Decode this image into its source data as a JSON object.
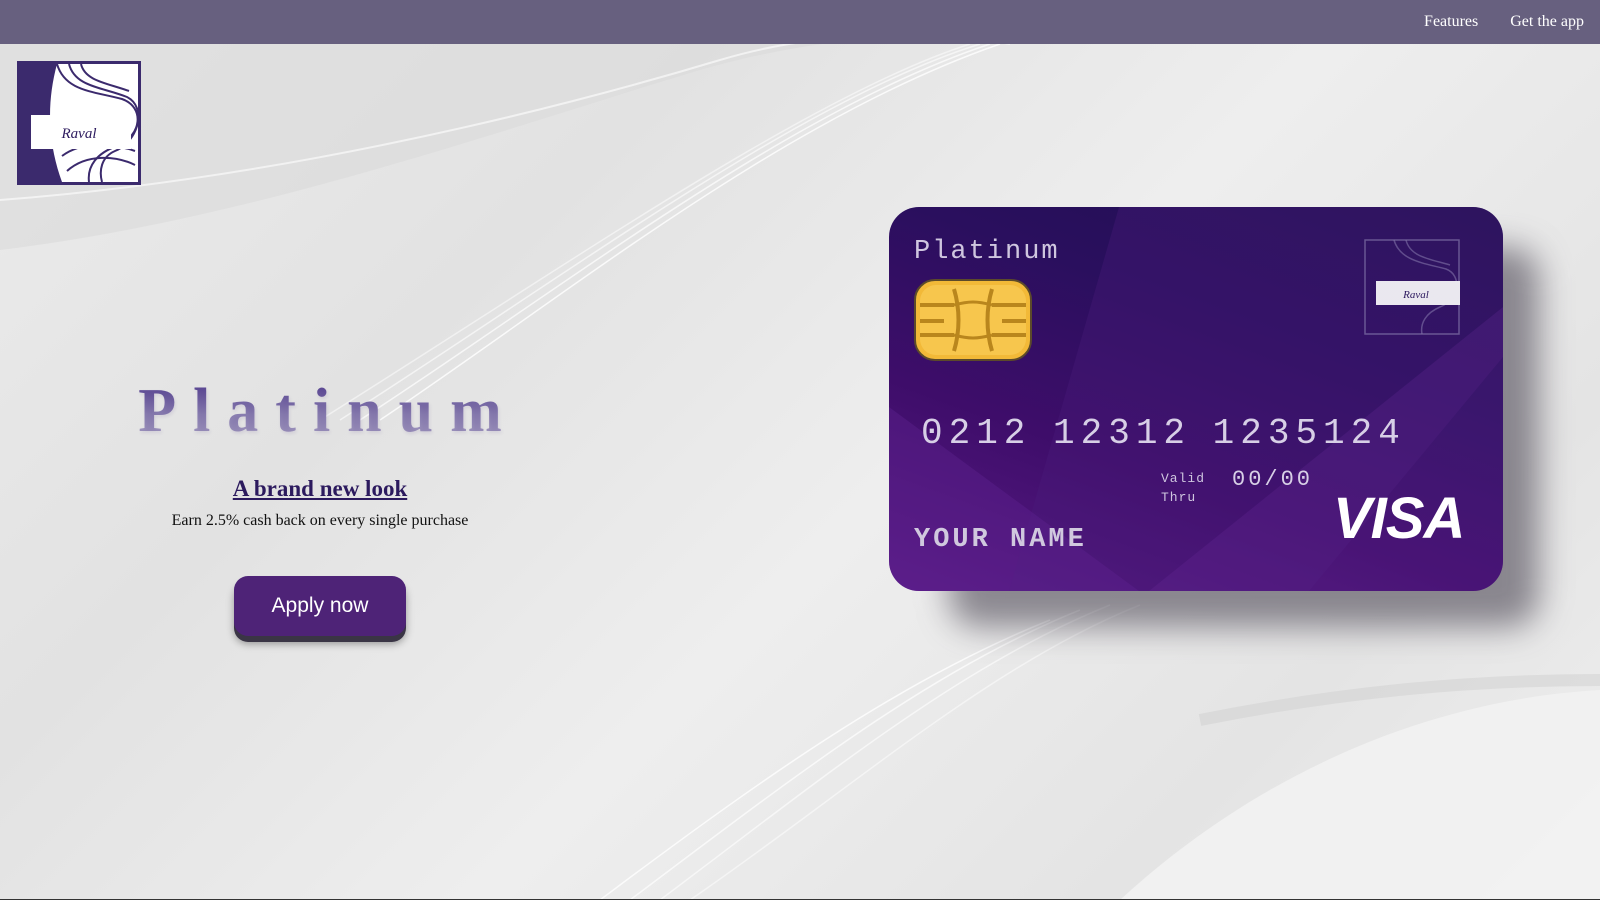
{
  "nav": {
    "features_label": "Features",
    "get_app_label": "Get the app"
  },
  "logo": {
    "brand_text": "Raval"
  },
  "hero": {
    "title": "Platinum",
    "subtitle": "A brand new look",
    "description": "Earn 2.5% cash back on every single purchase",
    "cta_label": "Apply now"
  },
  "card": {
    "tier": "Platinum",
    "number": "0212 12312 1235124",
    "valid_label_line1": "Valid",
    "valid_label_line2": "Thru",
    "valid_date": "00/00",
    "holder_name": "YOUR NAME",
    "network": "VISA",
    "brand_text": "Raval"
  },
  "colors": {
    "nav_bg": "#67607f",
    "accent": "#4e2377",
    "card_purple": "#3e0d6a",
    "chip_gold": "#f2b938"
  }
}
